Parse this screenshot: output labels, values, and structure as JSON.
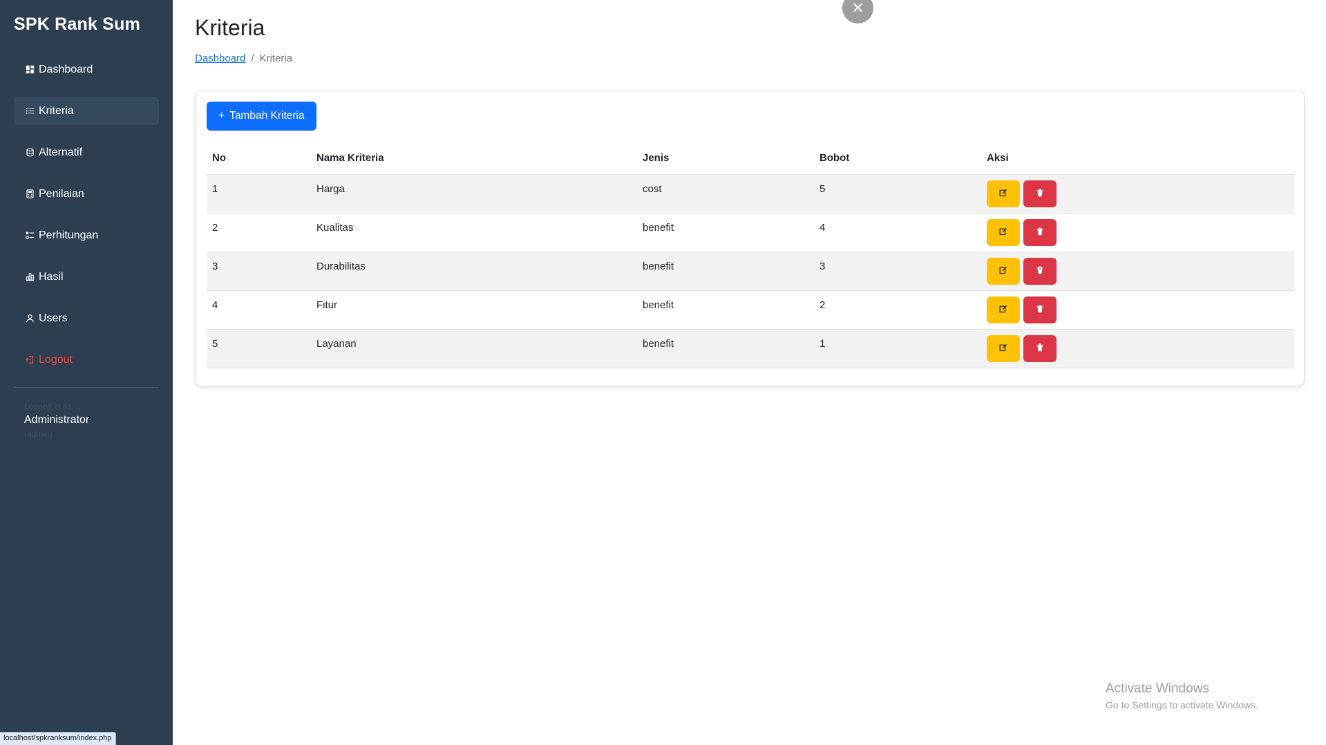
{
  "sidebar": {
    "brand": "SPK Rank Sum",
    "items": [
      {
        "label": "Dashboard",
        "icon": "dashboard-icon"
      },
      {
        "label": "Kriteria",
        "icon": "list-icon"
      },
      {
        "label": "Alternatif",
        "icon": "database-icon"
      },
      {
        "label": "Penilaian",
        "icon": "calculator-icon"
      },
      {
        "label": "Perhitungan",
        "icon": "ui-checks-icon"
      },
      {
        "label": "Hasil",
        "icon": "bar-chart-icon"
      },
      {
        "label": "Users",
        "icon": "person-icon"
      },
      {
        "label": "Logout",
        "icon": "logout-icon"
      }
    ],
    "active_item": "Kriteria",
    "logged_in_label": "Logged in as:",
    "user_name": "Administrator",
    "user_login": "(admin)"
  },
  "page": {
    "title": "Kriteria",
    "breadcrumb": {
      "home": "Dashboard",
      "separator": "/",
      "current": "Kriteria"
    }
  },
  "toolbar": {
    "add_label": "Tambah Kriteria"
  },
  "table": {
    "headers": [
      "No",
      "Nama Kriteria",
      "Jenis",
      "Bobot",
      "Aksi"
    ],
    "rows": [
      {
        "no": "1",
        "nama": "Harga",
        "jenis": "cost",
        "bobot": "5"
      },
      {
        "no": "2",
        "nama": "Kualitas",
        "jenis": "benefit",
        "bobot": "4"
      },
      {
        "no": "3",
        "nama": "Durabilitas",
        "jenis": "benefit",
        "bobot": "3"
      },
      {
        "no": "4",
        "nama": "Fitur",
        "jenis": "benefit",
        "bobot": "2"
      },
      {
        "no": "5",
        "nama": "Layanan",
        "jenis": "benefit",
        "bobot": "1"
      }
    ]
  },
  "overlay": {
    "close_icon": "close-icon"
  },
  "status_bar": {
    "url": "localhost/spkranksum/index.php"
  },
  "watermark": {
    "title": "Activate Windows",
    "subtitle": "Go to Settings to activate Windows."
  },
  "colors": {
    "sidebar_bg": "#2c3e50",
    "primary": "#0d6efd",
    "warning": "#ffc107",
    "danger": "#dc3545",
    "logout": "#e74c3c"
  }
}
